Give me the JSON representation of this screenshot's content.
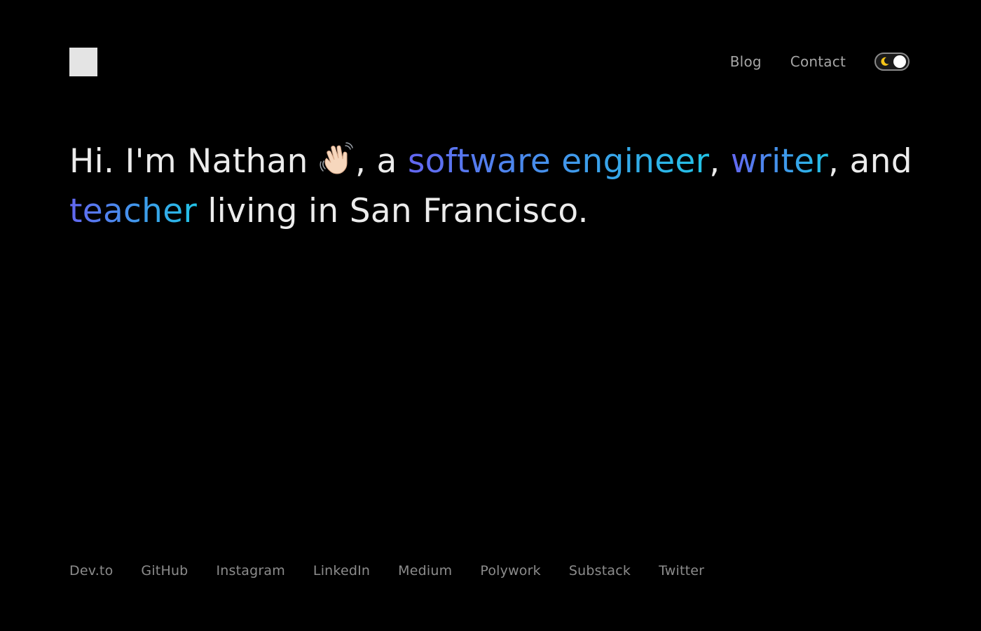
{
  "header": {
    "logo_icon": "square-logo-icon",
    "nav": [
      {
        "label": "Blog"
      },
      {
        "label": "Contact"
      }
    ],
    "theme_toggle": {
      "icon": "moon-icon",
      "state": "dark"
    }
  },
  "intro": {
    "part1": "Hi. I'm Nathan ",
    "emoji_icon": "waving-hand-icon",
    "part2": ", a ",
    "role1": "software engineer",
    "part3": ", ",
    "role2": "writer",
    "part4": ", and ",
    "role3": "teacher",
    "part5": " living in San Francisco."
  },
  "footer": {
    "links": [
      {
        "label": "Dev.to"
      },
      {
        "label": "GitHub"
      },
      {
        "label": "Instagram"
      },
      {
        "label": "LinkedIn"
      },
      {
        "label": "Medium"
      },
      {
        "label": "Polywork"
      },
      {
        "label": "Substack"
      },
      {
        "label": "Twitter"
      }
    ]
  },
  "colors": {
    "background": "#000000",
    "text": "#ececec",
    "gradient_start": "#6366f1",
    "gradient_end": "#22c3e6",
    "muted": "#8c8c8c"
  }
}
